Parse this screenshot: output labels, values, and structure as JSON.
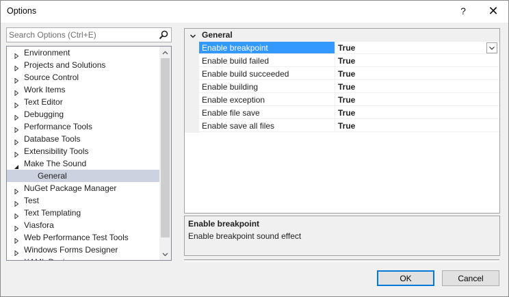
{
  "window": {
    "title": "Options",
    "help_label": "?",
    "close_label": "✕"
  },
  "search": {
    "placeholder": "Search Options (Ctrl+E)",
    "value": ""
  },
  "tree": {
    "items": [
      {
        "label": "Environment",
        "state": "collapsed"
      },
      {
        "label": "Projects and Solutions",
        "state": "collapsed"
      },
      {
        "label": "Source Control",
        "state": "collapsed"
      },
      {
        "label": "Work Items",
        "state": "collapsed"
      },
      {
        "label": "Text Editor",
        "state": "collapsed"
      },
      {
        "label": "Debugging",
        "state": "collapsed"
      },
      {
        "label": "Performance Tools",
        "state": "collapsed"
      },
      {
        "label": "Database Tools",
        "state": "collapsed"
      },
      {
        "label": "Extensibility Tools",
        "state": "collapsed"
      },
      {
        "label": "Make The Sound",
        "state": "expanded"
      },
      {
        "label": "General",
        "state": "child",
        "selected": true
      },
      {
        "label": "NuGet Package Manager",
        "state": "collapsed"
      },
      {
        "label": "Test",
        "state": "collapsed"
      },
      {
        "label": "Text Templating",
        "state": "collapsed"
      },
      {
        "label": "Viasfora",
        "state": "collapsed"
      },
      {
        "label": "Web Performance Test Tools",
        "state": "collapsed"
      },
      {
        "label": "Windows Forms Designer",
        "state": "collapsed"
      },
      {
        "label": "XAML Designer",
        "state": "collapsed"
      }
    ]
  },
  "grid": {
    "category": "General",
    "rows": [
      {
        "name": "Enable breakpoint",
        "value": "True",
        "selected": true
      },
      {
        "name": "Enable build failed",
        "value": "True"
      },
      {
        "name": "Enable build succeeded",
        "value": "True"
      },
      {
        "name": "Enable building",
        "value": "True"
      },
      {
        "name": "Enable exception",
        "value": "True"
      },
      {
        "name": "Enable file save",
        "value": "True"
      },
      {
        "name": "Enable save all files",
        "value": "True"
      }
    ]
  },
  "description": {
    "title": "Enable breakpoint",
    "text": "Enable breakpoint sound effect"
  },
  "buttons": {
    "ok": "OK",
    "cancel": "Cancel"
  },
  "colors": {
    "selection_blue": "#3399ff",
    "tree_selection": "#cdd2e0",
    "default_button_border": "#0078d7"
  },
  "icons": {
    "search": "search-icon",
    "tree_collapsed": "triangle-right-outline-icon",
    "tree_expanded": "triangle-down-filled-icon",
    "category": "chevron-down-icon",
    "dropdown": "chevron-down-icon",
    "scroll_up": "scroll-up-arrow-icon",
    "scroll_down": "scroll-down-arrow-icon"
  }
}
